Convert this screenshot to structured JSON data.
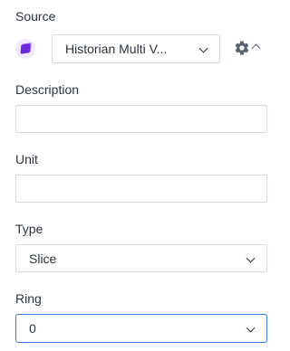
{
  "source": {
    "label": "Source",
    "value": "Historian Multi V...",
    "icon": "purple-cube-icon",
    "settings_icon": "gear-icon",
    "collapse_icon": "chevron-up-icon"
  },
  "description": {
    "label": "Description",
    "value": "",
    "placeholder": ""
  },
  "unit": {
    "label": "Unit",
    "value": "",
    "placeholder": ""
  },
  "type": {
    "label": "Type",
    "value": "Slice"
  },
  "ring": {
    "label": "Ring",
    "value": "0"
  },
  "colors": {
    "accent": "#3d7ee5",
    "icon": "#6c2bd9"
  }
}
